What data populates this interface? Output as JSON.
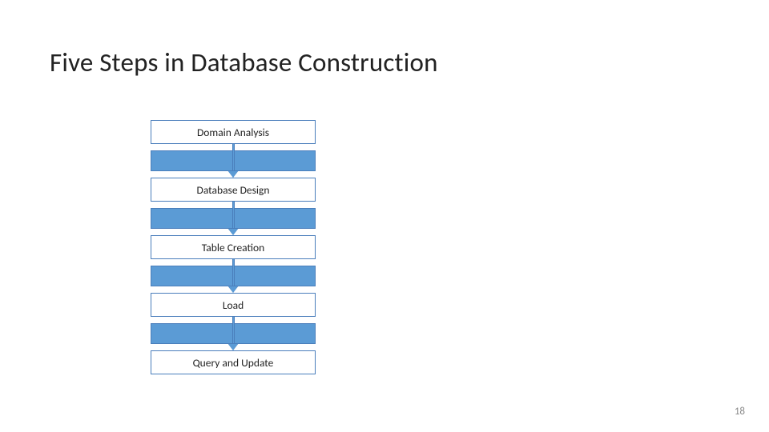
{
  "title": "Five Steps in Database Construction",
  "steps": [
    {
      "label": "Domain Analysis"
    },
    {
      "label": "Database Design"
    },
    {
      "label": "Table Creation"
    },
    {
      "label": "Load"
    },
    {
      "label": "Query and Update"
    }
  ],
  "page_number": "18",
  "colors": {
    "box_border": "#4a7ebb",
    "connector_fill": "#5b9bd5"
  }
}
